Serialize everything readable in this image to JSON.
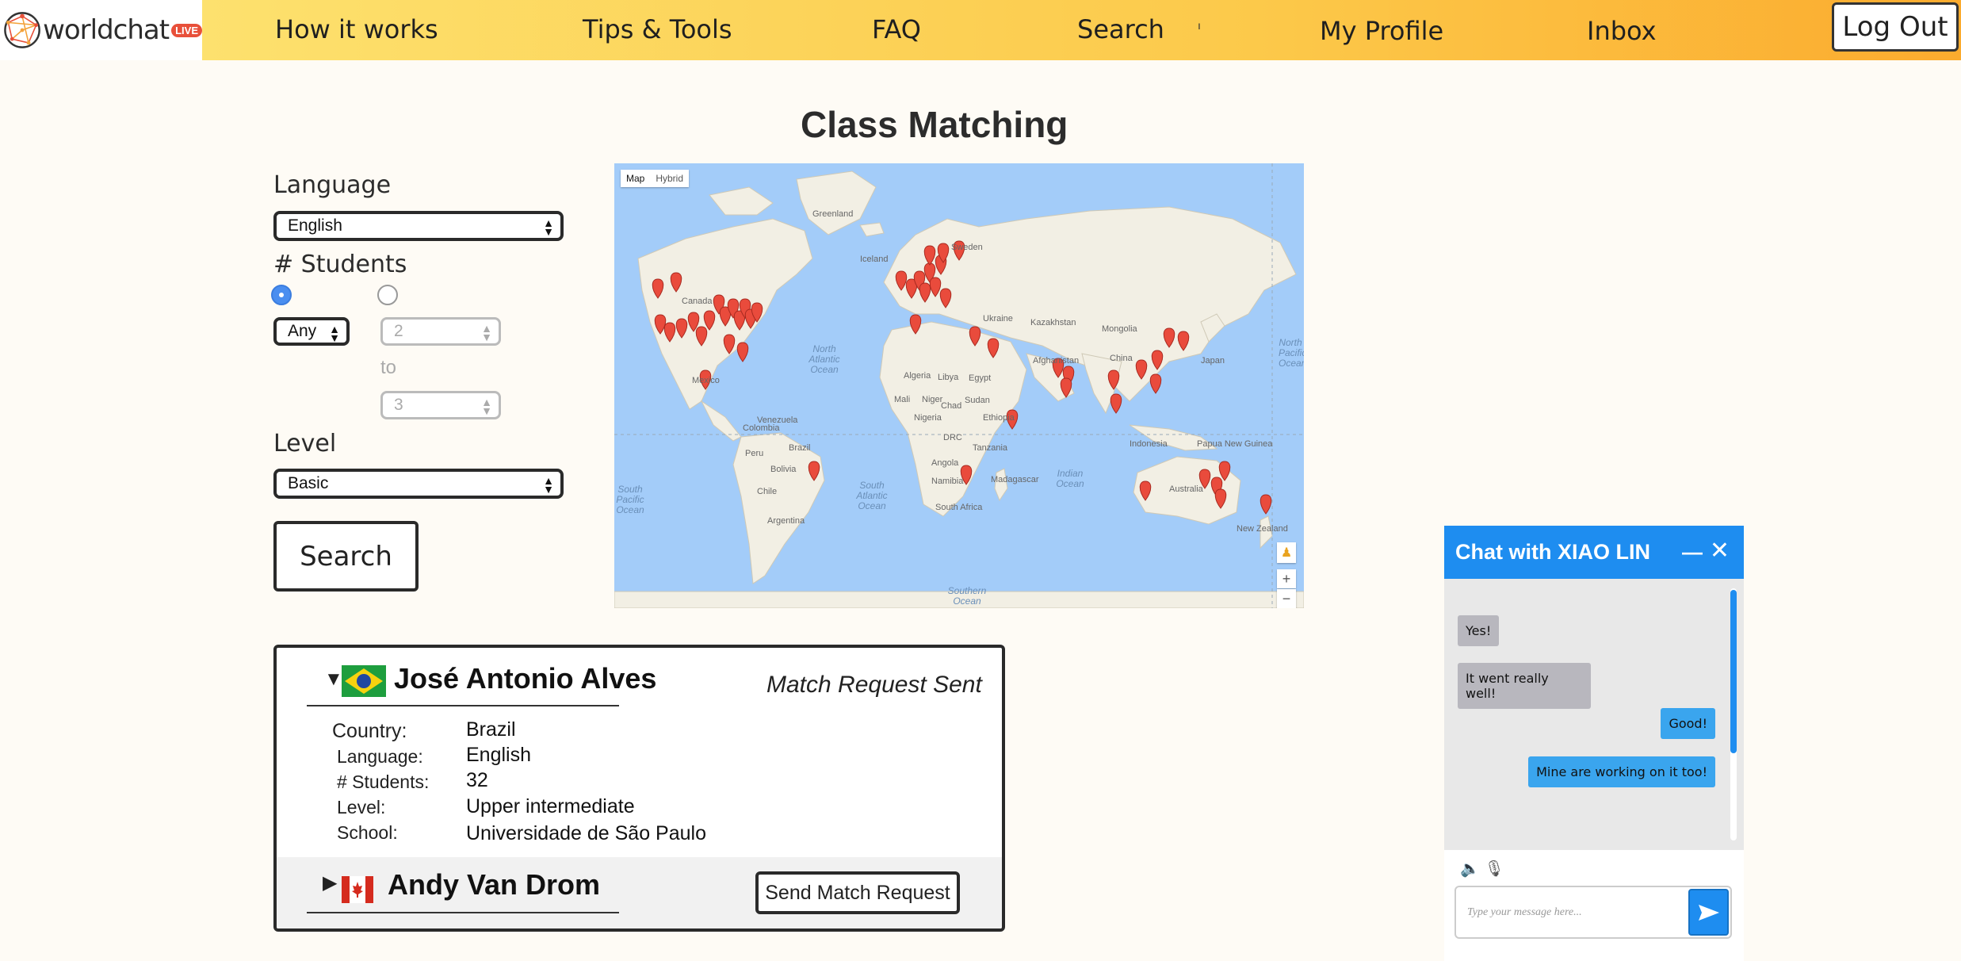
{
  "header": {
    "logo_text": "worldchat",
    "logo_badge": "LIVE",
    "nav": [
      {
        "label": "How it works"
      },
      {
        "label": "Tips & Tools"
      },
      {
        "label": "FAQ"
      },
      {
        "label": "Search"
      },
      {
        "label": "My Profile"
      },
      {
        "label": "Inbox"
      }
    ],
    "logout_label": "Log Out",
    "colors": {
      "gradient_start": "#fde16e",
      "gradient_end": "#fbab2e"
    }
  },
  "page_title": "Class Matching",
  "filters": {
    "language_label": "Language",
    "language_value": "English",
    "students_label": "# Students",
    "students_any_value": "Any",
    "students_range_from": "2",
    "students_range_to_label": "to",
    "students_range_to": "3",
    "level_label": "Level",
    "level_value": "Basic",
    "search_label": "Search"
  },
  "map": {
    "tab_map": "Map",
    "tab_hybrid": "Hybrid",
    "labels": {
      "greenland": "Greenland",
      "iceland": "Iceland",
      "canada": "Canada",
      "sweden": "Sweden",
      "ukraine": "Ukraine",
      "kazakhstan": "Kazakhstan",
      "mongolia": "Mongolia",
      "china": "China",
      "japan": "Japan",
      "mexico": "Mexico",
      "algeria": "Algeria",
      "libya": "Libya",
      "egypt": "Egypt",
      "afghanistan": "Afghanistan",
      "mali": "Mali",
      "niger": "Niger",
      "chad": "Chad",
      "sudan": "Sudan",
      "ethiopia": "Ethiopia",
      "nigeria": "Nigeria",
      "venezuela": "Venezuela",
      "colombia": "Colombia",
      "peru": "Peru",
      "brazil": "Brazil",
      "bolivia": "Bolivia",
      "chile": "Chile",
      "argentina": "Argentina",
      "drc": "DRC",
      "tanzania": "Tanzania",
      "angola": "Angola",
      "namibia": "Namibia",
      "south_africa": "South Africa",
      "madagascar": "Madagascar",
      "indonesia": "Indonesia",
      "png": "Papua New Guinea",
      "australia": "Australia",
      "new_zealand": "New Zealand",
      "north_atlantic": "North Atlantic Ocean",
      "north_pacific": "North Pacific Ocean",
      "south_atlantic": "South Atlantic Ocean",
      "south_pacific": "South Pacific Ocean",
      "indian_ocean": "Indian Ocean",
      "southern_ocean": "Southern Ocean"
    },
    "zoom_in": "+",
    "zoom_out": "−",
    "marker_color": "#e94b3c"
  },
  "results": [
    {
      "name": "José Antonio Alves",
      "status": "Match Request Sent",
      "expanded": true,
      "details": [
        {
          "label": "Country:",
          "value": "Brazil"
        },
        {
          "label": "Language:",
          "value": "English"
        },
        {
          "label": "# Students:",
          "value": "32"
        },
        {
          "label": "Level:",
          "value": "Upper intermediate"
        },
        {
          "label": "School:",
          "value": "Universidade de São Paulo"
        }
      ]
    },
    {
      "name": "Andy Van Drom",
      "action_label": "Send Match Request",
      "expanded": false
    }
  ],
  "chat": {
    "title": "Chat with  XIAO LIN",
    "messages": [
      {
        "from": "them",
        "text": "Yes!"
      },
      {
        "from": "them",
        "text": "It went really well!"
      },
      {
        "from": "me",
        "text": "Good!"
      },
      {
        "from": "me",
        "text": "Mine are working on it too!"
      }
    ],
    "input_placeholder": "Type your message here...",
    "accent": "#1e8df0"
  }
}
